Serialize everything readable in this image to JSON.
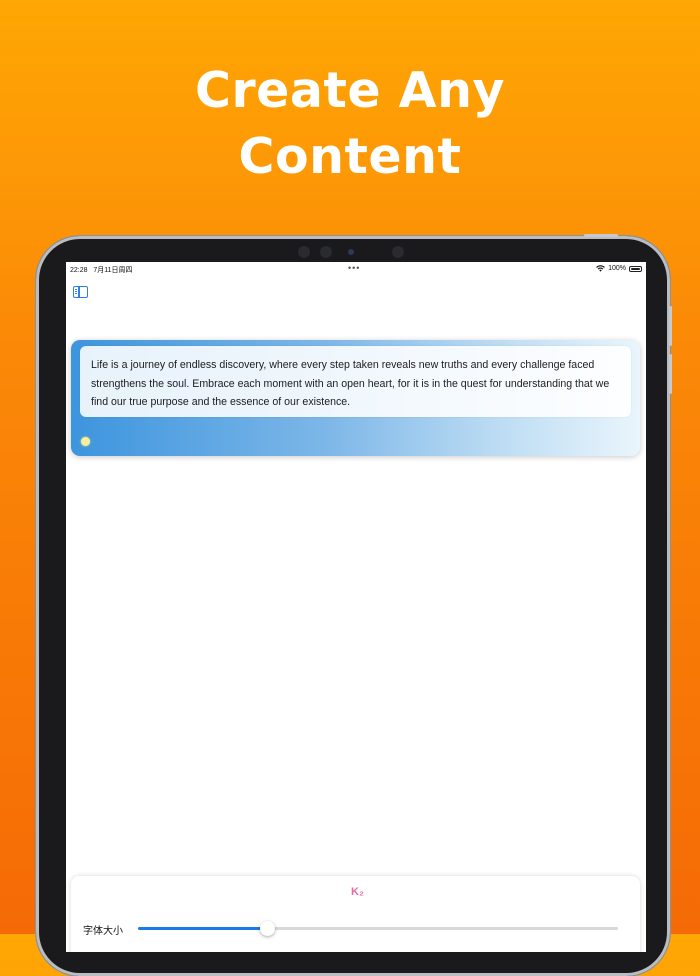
{
  "headline": {
    "line1": "Create Any",
    "line2": "Content"
  },
  "statusbar": {
    "time": "22:28",
    "date": "7月11日周四",
    "battery": "100%"
  },
  "card": {
    "quote": "Life is a journey of endless discovery, where every step taken reveals new truths and every challenge faced strengthens the soul. Embrace each moment with an open heart, for it is in the quest for understanding that we find our true purpose and the essence of our existence."
  },
  "panel": {
    "logo": "K₂",
    "font_size_label": "字体大小",
    "font_size_fraction": 0.27
  },
  "icons": {
    "sidebar": "sidebar-toggle-icon",
    "wifi": "wifi-icon",
    "battery": "battery-icon",
    "more": "more-dots-icon"
  },
  "colors": {
    "accent": "#1a7ae6",
    "background_top": "#ffa704",
    "background_bottom": "#f56a06"
  }
}
